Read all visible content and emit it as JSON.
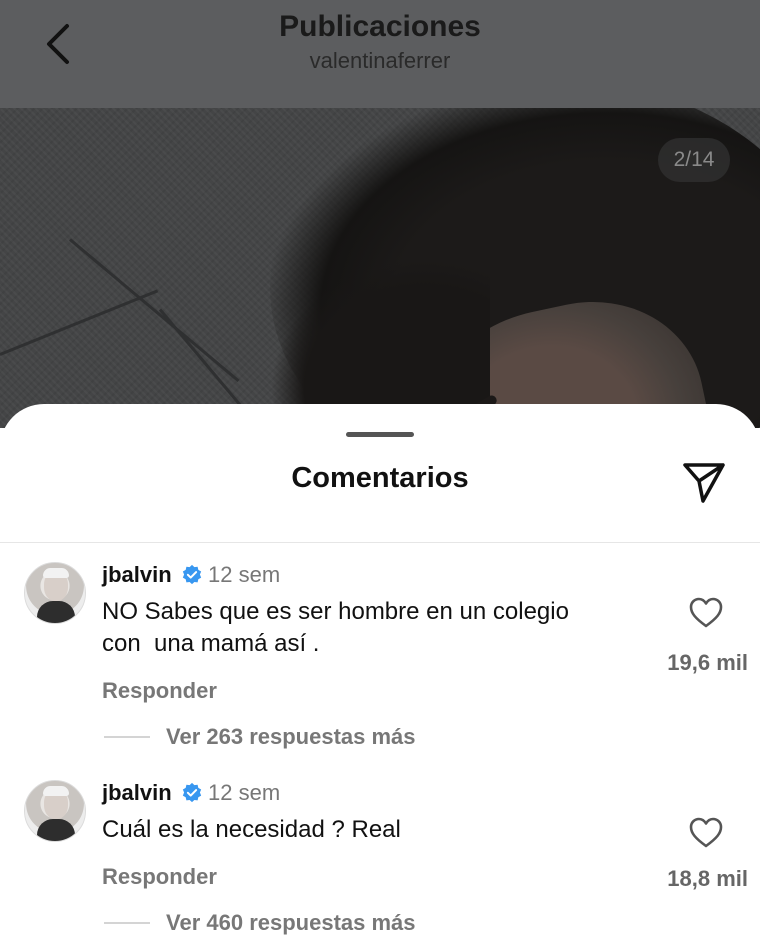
{
  "header": {
    "title": "Publicaciones",
    "subtitle": "valentinaferrer"
  },
  "post": {
    "page_counter": "2/14"
  },
  "comments_sheet": {
    "title": "Comentarios",
    "comments": [
      {
        "username": "jbalvin",
        "time": "12 sem",
        "text_line1": "NO Sabes que es ser hombre en un colegio",
        "text_line2": "con  una mamá así .",
        "reply_label": "Responder",
        "likes": "19,6 mil",
        "view_replies": "Ver 263 respuestas más"
      },
      {
        "username": "jbalvin",
        "time": "12 sem",
        "text_line1": "Cuál es la necesidad ? Real",
        "text_line2": "",
        "reply_label": "Responder",
        "likes": "18,8 mil",
        "view_replies": "Ver 460 respuestas más"
      }
    ]
  },
  "colors": {
    "verified_badge": "#3897f0",
    "header_overlay": "#5c5d5f"
  }
}
